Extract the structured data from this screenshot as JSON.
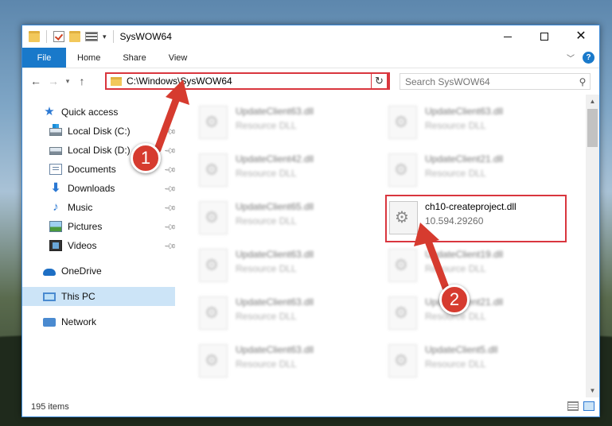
{
  "window": {
    "title": "SysWOW64"
  },
  "ribbon": {
    "tabs": [
      "File",
      "Home",
      "Share",
      "View"
    ]
  },
  "address": {
    "path": "C:\\Windows\\SysWOW64",
    "search_placeholder": "Search SysWOW64"
  },
  "nav": {
    "items": [
      {
        "label": "Quick access",
        "icon": "star-icon"
      },
      {
        "label": "Local Disk (C:)",
        "icon": "disk-icon"
      },
      {
        "label": "Local Disk (D:)",
        "icon": "disk-icon"
      },
      {
        "label": "Documents",
        "icon": "documents-icon"
      },
      {
        "label": "Downloads",
        "icon": "downloads-icon"
      },
      {
        "label": "Music",
        "icon": "music-icon"
      },
      {
        "label": "Pictures",
        "icon": "pictures-icon"
      },
      {
        "label": "Videos",
        "icon": "videos-icon"
      },
      {
        "label": "OneDrive",
        "icon": "onedrive-icon"
      },
      {
        "label": "This PC",
        "icon": "pc-icon"
      },
      {
        "label": "Network",
        "icon": "network-icon"
      }
    ]
  },
  "files": {
    "left": [
      {
        "name": "UpdateClient63.dll",
        "sub": "Resource DLL"
      },
      {
        "name": "UpdateClient42.dll",
        "sub": "Resource DLL"
      },
      {
        "name": "UpdateClient65.dll",
        "sub": "Resource DLL"
      },
      {
        "name": "UpdateClient63.dll",
        "sub": "Resource DLL"
      },
      {
        "name": "UpdateClient63.dll",
        "sub": "Resource DLL"
      },
      {
        "name": "UpdateClient63.dll",
        "sub": "Resource DLL"
      }
    ],
    "right": [
      {
        "name": "UpdateClient63.dll",
        "sub": "Resource DLL"
      },
      {
        "name": "UpdateClient21.dll",
        "sub": "Resource DLL"
      },
      {
        "name": "ch10-createproject.dll",
        "sub": "10.594.29260"
      },
      {
        "name": "UpdateClient19.dll",
        "sub": "Resource DLL"
      },
      {
        "name": "UpdateClient21.dll",
        "sub": "Resource DLL"
      },
      {
        "name": "UpdateClient5.dll",
        "sub": "Resource DLL"
      }
    ]
  },
  "status": {
    "items_count": "195 items"
  },
  "annotations": {
    "badge_1": "1",
    "badge_2": "2"
  },
  "colors": {
    "accent": "#1979ca",
    "annotation_red": "#d63b2f",
    "selection": "#cce4f7"
  }
}
